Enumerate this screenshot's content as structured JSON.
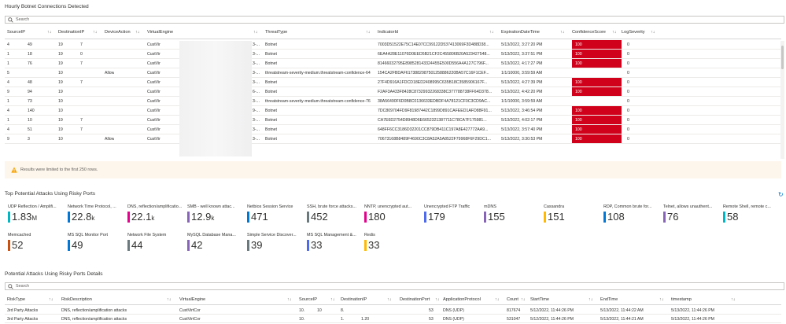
{
  "botnet": {
    "title": "Hourly Botnet Connections Detected",
    "search_placeholder": "Search",
    "columns": [
      "SourceIP",
      "DestinationIP",
      "DeviceAction",
      "VirtualEngine",
      "ThreatType",
      "IndicatorId",
      "ExpirationDateTime",
      "ConfidenceScore",
      "LogSeverity"
    ],
    "rows": [
      {
        "src": "4",
        "src2": "49",
        "dst": "19",
        "dst2": "7",
        "action": "",
        "ve": "CustVir",
        "ve2": "3-...",
        "threat": "Botnet",
        "indicator": "7003D51522E75C14E07CC99122D537413069F3D488D38...",
        "exp": "5/13/2022, 3:27:20 PM",
        "score": "100",
        "sev": "0",
        "red": true
      },
      {
        "src": "1",
        "src2": "18",
        "dst": "19",
        "dst2": "0",
        "action": "",
        "ve": "CustVir",
        "ve2": "3-...",
        "threat": "Botnet",
        "indicator": "6EA4A28E11076D0EED5B21CF2C455806B20A523427548...",
        "exp": "5/13/2022, 3:37:51 PM",
        "score": "100",
        "sev": "0",
        "red": true
      },
      {
        "src": "1",
        "src2": "76",
        "dst": "19",
        "dst2": "7",
        "action": "",
        "ve": "CustVir",
        "ve2": "3-...",
        "threat": "Botnet",
        "indicator": "81466032795E898528143324455E500D556A4A127C796F...",
        "exp": "5/13/2022, 4:17:27 PM",
        "score": "100",
        "sev": "0",
        "red": true
      },
      {
        "src": "5",
        "src2": "",
        "dst": "10",
        "dst2": "",
        "action": "Allow",
        "ve": "CustVir",
        "ve2": "3-...",
        "threat": "threatstream-severity-medium.threatstream-confidence-64",
        "indicator": "154CA2FBDAF6173882987501258886220BA57C16F1CEF...",
        "exp": "1/1/10000, 3:59:59 AM",
        "score": "",
        "sev": "0",
        "red": false
      },
      {
        "src": "4",
        "src2": "48",
        "dst": "19",
        "dst2": "7",
        "action": "",
        "ve": "CustVir",
        "ve2": "3-...",
        "threat": "Botnet",
        "indicator": "27F4D916A1FDCD18ED2408995C635B18C3585906167F...",
        "exp": "5/13/2022, 4:27:39 PM",
        "score": "100",
        "sev": "0",
        "red": true
      },
      {
        "src": "9",
        "src2": "94",
        "dst": "19",
        "dst2": "",
        "action": "",
        "ve": "CustVir",
        "ve2": "6-...",
        "threat": "Botnet",
        "indicator": "F2AF3A433F8428C87329932268338C377788738FF64D378...",
        "exp": "5/13/2022, 4:42:20 PM",
        "score": "100",
        "sev": "0",
        "red": true
      },
      {
        "src": "1",
        "src2": "73",
        "dst": "10",
        "dst2": "",
        "action": "",
        "ve": "CustVir",
        "ve2": "3-...",
        "threat": "threatstream-severity-medium.threatstream-confidence-76",
        "indicator": "38A56490F6D0B8C0136633EDBDF4A78121CF0C3CD9AC...",
        "exp": "1/1/10000, 3:59:59 AM",
        "score": "",
        "sev": "0",
        "red": false
      },
      {
        "src": "4",
        "src2": "140",
        "dst": "10",
        "dst2": "",
        "action": "",
        "ve": "CustVir",
        "ve2": "9-...",
        "threat": "Botnet",
        "indicator": "7DC809704FD9F81987442C1899D891CAFEED1AFD88F91...",
        "exp": "5/13/2022, 3:46:54 PM",
        "score": "100",
        "sev": "0",
        "red": true
      },
      {
        "src": "1",
        "src2": "10",
        "dst": "19",
        "dst2": "7",
        "action": "",
        "ve": "CustVir",
        "ve2": "3-...",
        "threat": "Botnet",
        "indicator": "CA7E6D2754D8948D6E6652321387711C78CA7F175981...",
        "exp": "5/13/2022, 4:02:17 PM",
        "score": "100",
        "sev": "0",
        "red": true
      },
      {
        "src": "4",
        "src2": "51",
        "dst": "19",
        "dst2": "7",
        "action": "",
        "ve": "CustVir",
        "ve2": "3-...",
        "threat": "Botnet",
        "indicator": "648FF6CC3186D32201CC879DB411C197A8E427772AA9...",
        "exp": "5/13/2022, 3:57:40 PM",
        "score": "100",
        "sev": "0",
        "red": true
      },
      {
        "src": "9",
        "src2": "3",
        "dst": "10",
        "dst2": "",
        "action": "Allow",
        "ve": "CustVir",
        "ve2": "3-...",
        "threat": "Botnet",
        "indicator": "70673168B8489F4690C3C8A52A5A8522F79968F6F29DC1...",
        "exp": "5/13/2022, 3:30:53 PM",
        "score": "100",
        "sev": "0",
        "red": true
      }
    ],
    "warning": "Results were limited to the first 250 rows."
  },
  "ports": {
    "title": "Top Potential Attacks Using Risky Ports",
    "tiles": [
      {
        "label": "UDP Reflection / Amplifi...",
        "value": "1.83",
        "unit": "M",
        "color": "#00b7c3"
      },
      {
        "label": "Network Time Protocol, ...",
        "value": "22.8",
        "unit": "k",
        "color": "#0078d4"
      },
      {
        "label": "DNS, reflection/amplificatio...",
        "value": "22.1",
        "unit": "k",
        "color": "#e3008c"
      },
      {
        "label": "SMB - well known attac...",
        "value": "12.9",
        "unit": "k",
        "color": "#8764b8"
      },
      {
        "label": "Netbios Session Service",
        "value": "471",
        "unit": "",
        "color": "#0078d4"
      },
      {
        "label": "SSH, brute force attacks...",
        "value": "452",
        "unit": "",
        "color": "#69797e"
      },
      {
        "label": "NNTP, unencrypted aut...",
        "value": "180",
        "unit": "",
        "color": "#e3008c"
      },
      {
        "label": "Unencrypted FTP Traffic",
        "value": "179",
        "unit": "",
        "color": "#4f6bed"
      },
      {
        "label": "mDNS",
        "value": "155",
        "unit": "",
        "color": "#8764b8"
      },
      {
        "label": "Cassandra",
        "value": "151",
        "unit": "",
        "color": "#ffb900"
      },
      {
        "label": "RDP, Common brute for...",
        "value": "108",
        "unit": "",
        "color": "#0078d4"
      },
      {
        "label": "Telnet, allows unauthent...",
        "value": "76",
        "unit": "",
        "color": "#8764b8"
      },
      {
        "label": "Remote Shell, remote c...",
        "value": "58",
        "unit": "",
        "color": "#00b7c3"
      },
      {
        "label": "Memcached",
        "value": "52",
        "unit": "",
        "color": "#ca5010"
      },
      {
        "label": "MS SQL Monitor Port",
        "value": "49",
        "unit": "",
        "color": "#0078d4"
      },
      {
        "label": "Network File System",
        "value": "44",
        "unit": "",
        "color": "#69797e"
      },
      {
        "label": "MySQL Database Mana...",
        "value": "42",
        "unit": "",
        "color": "#8764b8"
      },
      {
        "label": "Simple Service Discover...",
        "value": "39",
        "unit": "",
        "color": "#69797e"
      },
      {
        "label": "MS SQL Management &...",
        "value": "33",
        "unit": "",
        "color": "#4f6bed"
      },
      {
        "label": "Redis",
        "value": "33",
        "unit": "",
        "color": "#ffb900"
      }
    ]
  },
  "details": {
    "title": "Potential Attacks Using Risky Ports Details",
    "search_placeholder": "Search",
    "columns": [
      "RiskType",
      "RiskDescription",
      "VirtualEngine",
      "SourceIP",
      "DestinationIP",
      "DestinationPort",
      "ApplicationProtocol",
      "Count",
      "StartTime",
      "EndTime",
      "timestamp"
    ],
    "rows": [
      {
        "type": "3rd Party Attacks",
        "desc": "DNS, reflection/amplification attacks",
        "ve": "CustVirtCor",
        "src": "10.",
        "src2": "10",
        "dst": "8.",
        "dport": "53",
        "proto": "DNS (UDP)",
        "count": "817674",
        "start": "5/12/2022, 11:44:26 PM",
        "end": "5/13/2022, 11:44:22 AM",
        "ts": "5/13/2022, 11:44:26 PM"
      },
      {
        "type": "3rd Party Attacks",
        "desc": "DNS, reflection/amplification attacks",
        "ve": "CustVirtCor",
        "src": "10.",
        "src2": "",
        "dst": "1.",
        "dst2": "1.20",
        "dport": "53",
        "proto": "DNS (UDP)",
        "count": "531047",
        "start": "5/12/2022, 11:44:26 PM",
        "end": "5/13/2022, 11:44:21 AM",
        "ts": "5/13/2022, 11:44:26 PM"
      }
    ]
  }
}
